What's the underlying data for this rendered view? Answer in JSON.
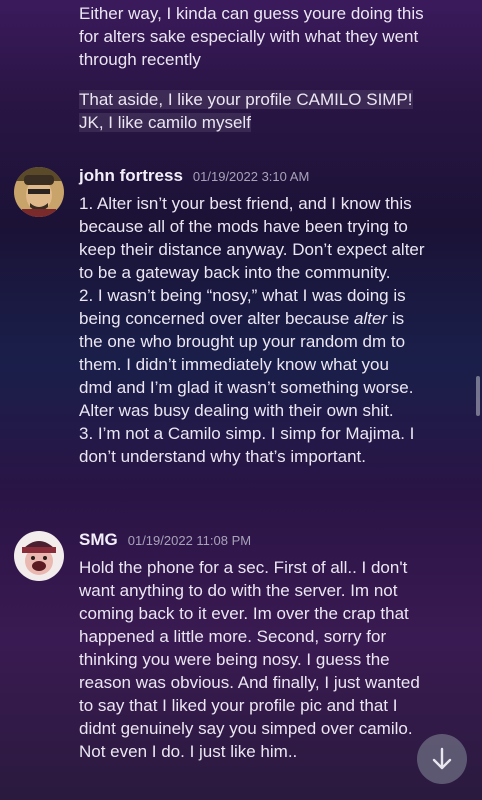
{
  "continuation": {
    "lines": [
      "Either way, I kinda can guess youre doing this",
      "for alters sake especially with what they went",
      "through recently"
    ],
    "highlighted_lines": [
      "That aside, I like your profile CAMILO SIMP!",
      "JK, I like camilo myself"
    ]
  },
  "messages": [
    {
      "username": "john fortress",
      "timestamp": "01/19/2022 3:10 AM",
      "lines_pre": [
        "1. Alter isn’t your best friend, and I know this",
        "because all of the mods have been trying to",
        "keep their distance anyway. Don’t expect alter",
        "to be a gateway back into the community.",
        "2. I wasn’t being “nosy,” what I was doing is"
      ],
      "line_italic_before": "being concerned over alter because ",
      "line_italic_word": "alter",
      "line_italic_after": " is",
      "lines_post": [
        "the one who brought up your random dm to",
        "them. I didn’t immediately know what you",
        "dmd and I’m glad it wasn’t something worse.",
        "Alter was busy dealing with their own shit.",
        "3. I’m not a Camilo simp. I simp for Majima. I",
        "don’t understand why that’s important."
      ]
    },
    {
      "username": "SMG",
      "timestamp": "01/19/2022 11:08 PM",
      "lines": [
        "Hold the phone for a sec. First of all.. I don't",
        "want anything to do with the server. Im not",
        "coming back to it ever. Im over the crap that",
        "happened a little more. Second, sorry for",
        "thinking you were being nosy. I guess the",
        "reason was obvious. And finally, I just wanted",
        "to say that I liked your profile pic and that I",
        "didnt genuinely say you simped over camilo.",
        "Not even I do. I just like him.."
      ]
    }
  ],
  "colors": {
    "username": "#f2eef8",
    "timestamp": "#a8a2b8",
    "text": "#ebe6f2"
  },
  "icons": {
    "scroll_down": "arrow-down-icon"
  }
}
